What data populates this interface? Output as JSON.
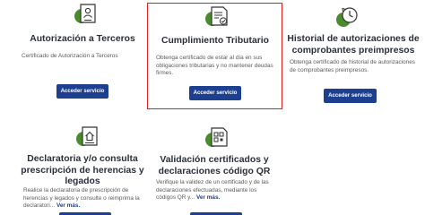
{
  "button_label": "Acceder servicio",
  "more_label": "Ver más.",
  "colors": {
    "accent_green": "#4a8c2a",
    "button_blue": "#1d3f8f",
    "highlight_red": "#e02020"
  },
  "cards": [
    {
      "title": "Autorización a Terceros",
      "desc": "Certificado de Autorización a Terceros",
      "icon": "person-certificate-icon"
    },
    {
      "title": "Cumplimiento Tributario",
      "desc": "Obtenga certificado de estar al día en sus obligaciones tributarias y no mantener deudas firmes.",
      "icon": "document-check-icon",
      "highlighted": true
    },
    {
      "title": "Historial de autorizaciones de comprobantes preimpresos",
      "desc": "Obtenga certificado de historial de autorizaciones de comprobantes preimpresos.",
      "icon": "history-clock-icon"
    },
    {
      "title": "Declaratoria y/o consulta prescripción de herencias y legados",
      "desc": "Realice la declaratoria de prescripción de herencias y legados y consulte o reimprima la declaratori...",
      "icon": "house-document-icon"
    },
    {
      "title": "Validación certificados y declaraciones código QR",
      "desc": "Verifique la validez de un certificado y de las declaraciones efectuadas, mediante los códigos QR y...",
      "icon": "qr-document-icon"
    }
  ]
}
